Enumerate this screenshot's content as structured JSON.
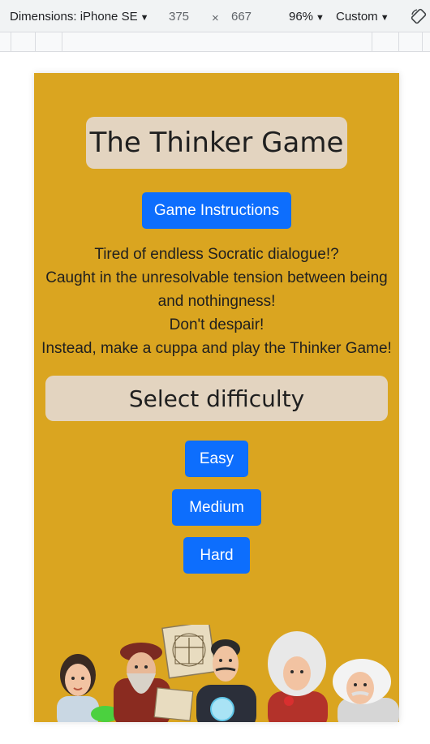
{
  "devtools": {
    "dimensions_label": "Dimensions: iPhone SE",
    "width": "375",
    "times": "×",
    "height": "667",
    "zoom": "96%",
    "throttle": "Custom",
    "caret": "▼"
  },
  "page": {
    "title": "The Thinker Game",
    "instructions_button": "Game Instructions",
    "intro_lines": [
      "Tired of endless Socratic dialogue!?",
      "Caught in the unresolvable tension between being",
      "and nothingness!",
      "Don't despair!",
      "Instead, make a cuppa and play the Thinker Game!"
    ],
    "difficulty_heading": "Select difficulty",
    "difficulty_buttons": {
      "easy": "Easy",
      "medium": "Medium",
      "hard": "Hard"
    }
  },
  "colors": {
    "page_background": "#daa520",
    "heading_box": "#e3d4c0",
    "button": "#0d6efd"
  }
}
